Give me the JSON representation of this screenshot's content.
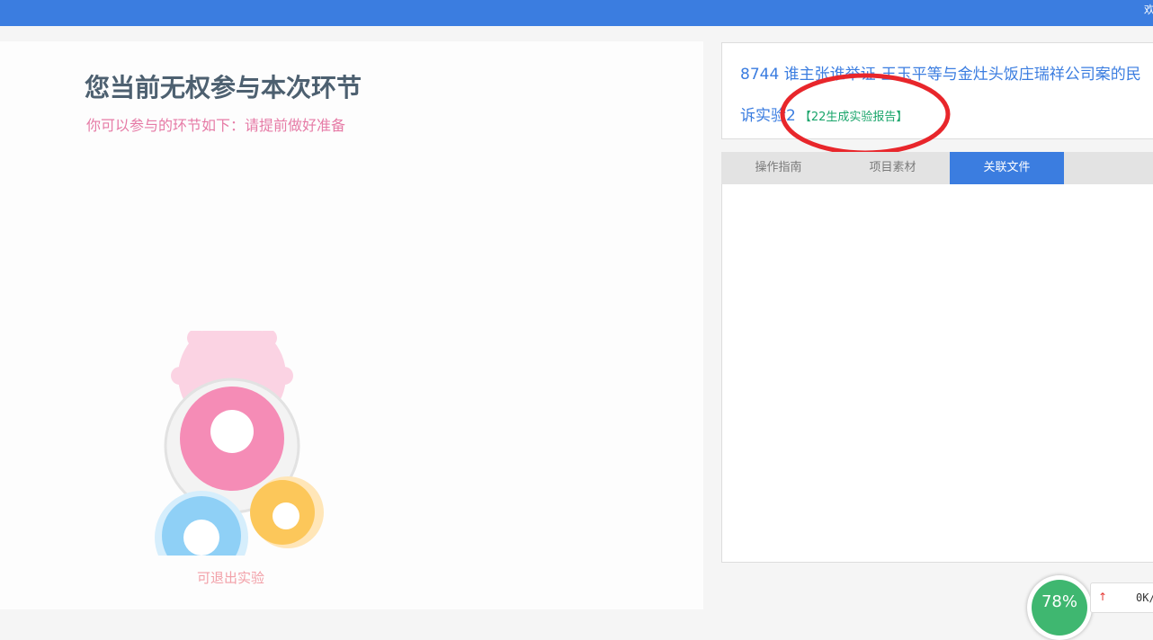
{
  "header": {
    "welcome_partial": "欢"
  },
  "left": {
    "title": "您当前无权参与本次环节",
    "subtitle": "你可以参与的环节如下：请提前做好准备",
    "exit_label": "可退出实验"
  },
  "case_info": {
    "line1": "8744 谁主张谁举证-王玉平等与金灶头饭庄瑞祥公司案的民",
    "line2": "诉实验2",
    "badge": "【22生成实验报告】"
  },
  "tabs": [
    {
      "label": "操作指南",
      "active": false
    },
    {
      "label": "项目素材",
      "active": false
    },
    {
      "label": "关联文件",
      "active": true
    }
  ],
  "speed_widget": {
    "percent": "78%",
    "speed": "0K/"
  },
  "colors": {
    "accent": "#3b7de0",
    "title": "#4d6070",
    "pink": "#e67ba6",
    "green": "#1aa56b",
    "annotation_red": "#e8262b"
  }
}
